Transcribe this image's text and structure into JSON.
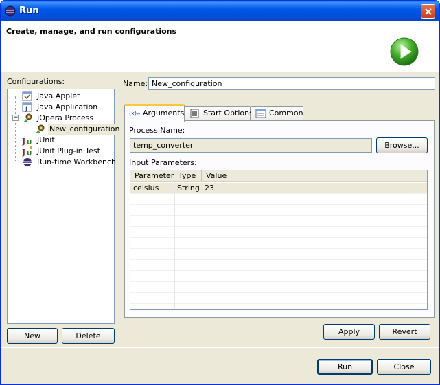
{
  "window": {
    "title": "Run"
  },
  "header": {
    "title": "Create, manage, and run configurations"
  },
  "left": {
    "label": "Configurations:",
    "tree": [
      {
        "label": "Java Applet",
        "icon": "java-applet-icon"
      },
      {
        "label": "Java Application",
        "icon": "java-application-icon"
      },
      {
        "label": "JOpera Process",
        "icon": "jopera-process-icon",
        "expanded": true
      },
      {
        "label": "New_configuration",
        "icon": "jopera-config-icon",
        "selected": true
      },
      {
        "label": "JUnit",
        "icon": "junit-icon"
      },
      {
        "label": "JUnit Plug-in Test",
        "icon": "junit-plugin-icon"
      },
      {
        "label": "Run-time Workbench",
        "icon": "workbench-icon"
      }
    ],
    "new_button": "New",
    "delete_button": "Delete"
  },
  "form": {
    "name_label": "Name:",
    "name_value": "New_configuration",
    "tabs": [
      {
        "label": "Arguments",
        "icon": "arguments-icon",
        "active": true
      },
      {
        "label": "Start Options",
        "icon": "start-options-icon"
      },
      {
        "label": "Common",
        "icon": "common-icon"
      }
    ],
    "process_name_label": "Process Name:",
    "process_name_value": "temp_converter",
    "browse_button": "Browse...",
    "input_parameters_label": "Input Parameters:",
    "table": {
      "columns": [
        "Parameter",
        "Type",
        "Value"
      ],
      "rows": [
        {
          "parameter": "celsius",
          "type": "String",
          "value": "23"
        }
      ]
    },
    "apply_button": "Apply",
    "revert_button": "Revert"
  },
  "footer": {
    "run_button": "Run",
    "close_button": "Close"
  }
}
